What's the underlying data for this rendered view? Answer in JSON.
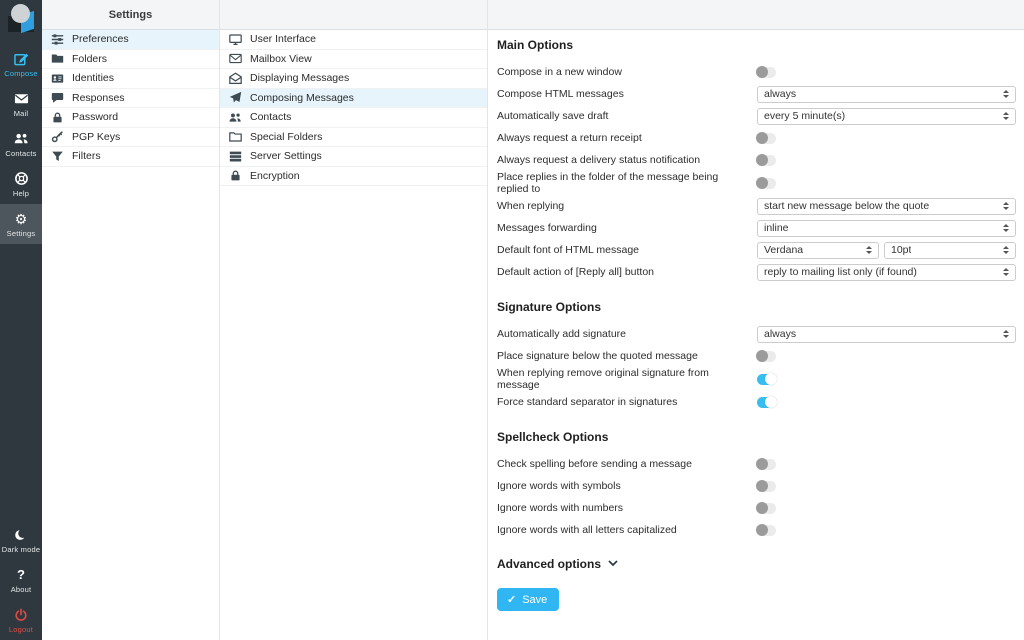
{
  "colors": {
    "accent": "#37bef0",
    "sidebar_bg": "#2e383e",
    "sidebar_active_bg": "#4d565c",
    "selection_bg": "#e7f4fc",
    "save_button_bg": "#30b6f2",
    "logout_red": "#e14b45",
    "header_bg": "#f3f5f6"
  },
  "sidebar": {
    "items": [
      {
        "label": "Compose",
        "icon": "compose-icon"
      },
      {
        "label": "Mail",
        "icon": "mail-icon"
      },
      {
        "label": "Contacts",
        "icon": "contacts-icon"
      },
      {
        "label": "Help",
        "icon": "help-icon"
      },
      {
        "label": "Settings",
        "icon": "settings-gear-icon",
        "active": true
      }
    ],
    "footer": [
      {
        "label": "Dark mode",
        "icon": "moon-icon"
      },
      {
        "label": "About",
        "icon": "question-icon"
      },
      {
        "label": "Logout",
        "icon": "power-icon"
      }
    ]
  },
  "settings_nav": {
    "title": "Settings",
    "items": [
      {
        "label": "Preferences",
        "icon": "sliders-icon",
        "selected": true
      },
      {
        "label": "Folders",
        "icon": "folder-icon"
      },
      {
        "label": "Identities",
        "icon": "id-card-icon"
      },
      {
        "label": "Responses",
        "icon": "comment-icon"
      },
      {
        "label": "Password",
        "icon": "lock-icon"
      },
      {
        "label": "PGP Keys",
        "icon": "key-icon"
      },
      {
        "label": "Filters",
        "icon": "filter-icon"
      }
    ]
  },
  "sections_nav": {
    "items": [
      {
        "label": "User Interface",
        "icon": "monitor-icon"
      },
      {
        "label": "Mailbox View",
        "icon": "envelope-icon"
      },
      {
        "label": "Displaying Messages",
        "icon": "envelope-open-icon"
      },
      {
        "label": "Composing Messages",
        "icon": "paper-plane-icon",
        "selected": true
      },
      {
        "label": "Contacts",
        "icon": "users-icon"
      },
      {
        "label": "Special Folders",
        "icon": "folder-open-icon"
      },
      {
        "label": "Server Settings",
        "icon": "server-icon"
      },
      {
        "label": "Encryption",
        "icon": "lock-icon"
      }
    ]
  },
  "main": {
    "sections": [
      {
        "heading": "Main Options",
        "rows": [
          {
            "label": "Compose in a new window",
            "control": "toggle",
            "state": "off"
          },
          {
            "label": "Compose HTML messages",
            "control": "select",
            "value": "always"
          },
          {
            "label": "Automatically save draft",
            "control": "select",
            "value": "every 5 minute(s)"
          },
          {
            "label": "Always request a return receipt",
            "control": "toggle",
            "state": "off"
          },
          {
            "label": "Always request a delivery status notification",
            "control": "toggle",
            "state": "off"
          },
          {
            "label": "Place replies in the folder of the message being replied to",
            "control": "toggle",
            "state": "off"
          },
          {
            "label": "When replying",
            "control": "select",
            "value": "start new message below the quote"
          },
          {
            "label": "Messages forwarding",
            "control": "select",
            "value": "inline"
          },
          {
            "label": "Default font of HTML message",
            "control": "select-pair",
            "value": "Verdana",
            "value2": "10pt"
          },
          {
            "label": "Default action of [Reply all] button",
            "control": "select",
            "value": "reply to mailing list only (if found)"
          }
        ]
      },
      {
        "heading": "Signature Options",
        "rows": [
          {
            "label": "Automatically add signature",
            "control": "select",
            "value": "always"
          },
          {
            "label": "Place signature below the quoted message",
            "control": "toggle",
            "state": "off"
          },
          {
            "label": "When replying remove original signature from message",
            "control": "toggle",
            "state": "on"
          },
          {
            "label": "Force standard separator in signatures",
            "control": "toggle",
            "state": "on"
          }
        ]
      },
      {
        "heading": "Spellcheck Options",
        "rows": [
          {
            "label": "Check spelling before sending a message",
            "control": "toggle",
            "state": "off"
          },
          {
            "label": "Ignore words with symbols",
            "control": "toggle",
            "state": "off"
          },
          {
            "label": "Ignore words with numbers",
            "control": "toggle",
            "state": "off"
          },
          {
            "label": "Ignore words with all letters capitalized",
            "control": "toggle",
            "state": "off"
          }
        ]
      }
    ],
    "advanced": {
      "label": "Advanced options",
      "icon": "chevron-down-icon"
    },
    "save_button": {
      "label": "Save",
      "icon": "check-icon"
    }
  }
}
